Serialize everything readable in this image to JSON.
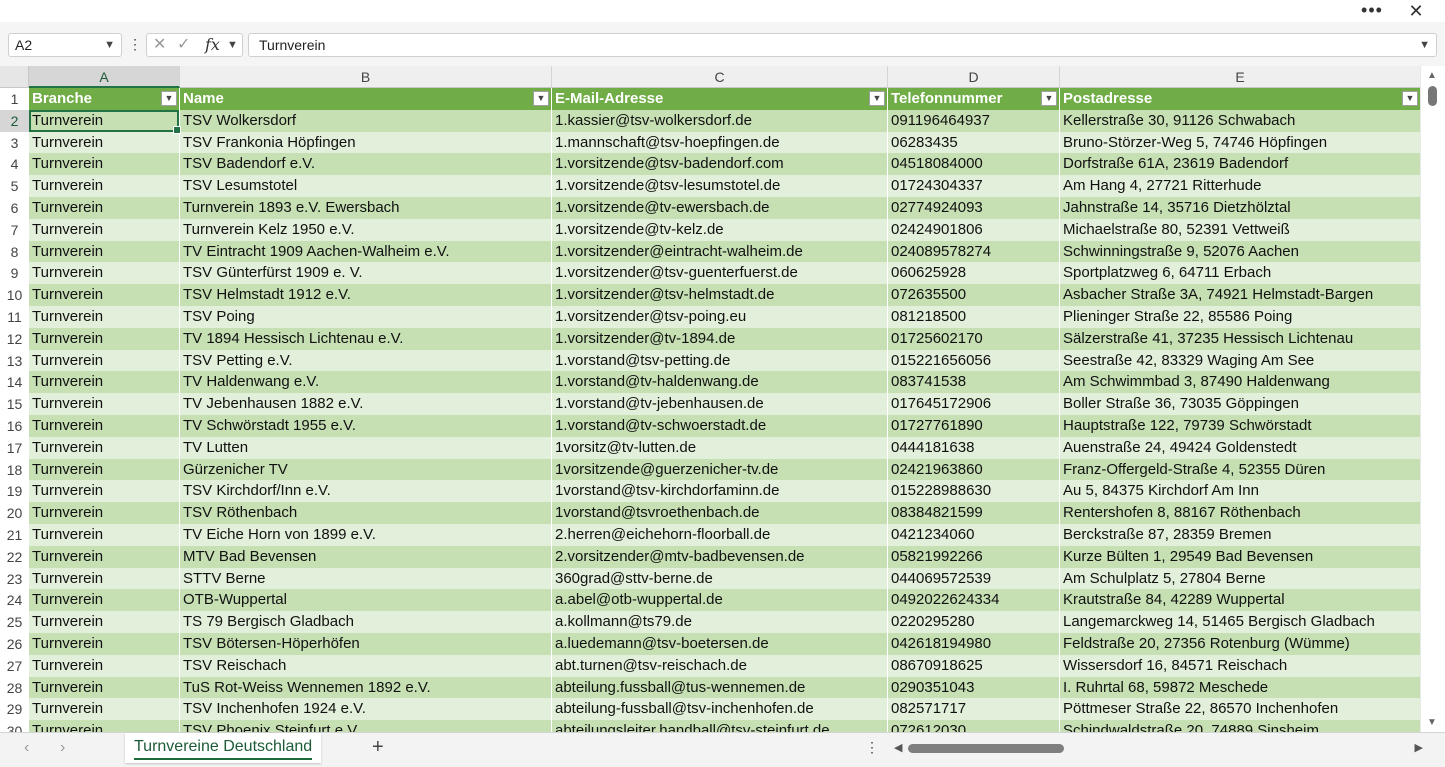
{
  "window": {
    "more_label": "•••",
    "close_label": "✕"
  },
  "formula_bar": {
    "name_box": "A2",
    "cancel_icon": "✕",
    "enter_icon": "✓",
    "fx_label": "fx",
    "content": "Turnverein"
  },
  "columns": [
    "A",
    "B",
    "C",
    "D",
    "E"
  ],
  "table": {
    "headers": [
      "Branche",
      "Name",
      "E-Mail-Adresse",
      "Telefonnummer",
      "Postadresse"
    ],
    "rows": [
      {
        "num": "2",
        "cells": [
          "Turnverein",
          "TSV Wolkersdorf",
          "1.kassier@tsv-wolkersdorf.de",
          "091196464937",
          "Kellerstraße 30, 91126 Schwabach"
        ]
      },
      {
        "num": "3",
        "cells": [
          "Turnverein",
          "TSV Frankonia Höpfingen",
          "1.mannschaft@tsv-hoepfingen.de",
          "06283435",
          "Bruno-Störzer-Weg 5, 74746 Höpfingen"
        ]
      },
      {
        "num": "4",
        "cells": [
          "Turnverein",
          "TSV Badendorf e.V.",
          "1.vorsitzende@tsv-badendorf.com",
          "04518084000",
          "Dorfstraße 61A, 23619 Badendorf"
        ]
      },
      {
        "num": "5",
        "cells": [
          "Turnverein",
          "TSV Lesumstotel",
          "1.vorsitzende@tsv-lesumstotel.de",
          "01724304337",
          "Am Hang 4, 27721 Ritterhude"
        ]
      },
      {
        "num": "6",
        "cells": [
          "Turnverein",
          "Turnverein 1893 e.V. Ewersbach",
          "1.vorsitzende@tv-ewersbach.de",
          "02774924093",
          "Jahnstraße 14, 35716 Dietzhölztal"
        ]
      },
      {
        "num": "7",
        "cells": [
          "Turnverein",
          "Turnverein Kelz 1950 e.V.",
          "1.vorsitzende@tv-kelz.de",
          "02424901806",
          "Michaelstraße 80, 52391 Vettweiß"
        ]
      },
      {
        "num": "8",
        "cells": [
          "Turnverein",
          "TV Eintracht 1909 Aachen-Walheim e.V.",
          "1.vorsitzender@eintracht-walheim.de",
          "024089578274",
          "Schwinningstraße 9, 52076 Aachen"
        ]
      },
      {
        "num": "9",
        "cells": [
          "Turnverein",
          "TSV Günterfürst 1909 e. V.",
          "1.vorsitzender@tsv-guenterfuerst.de",
          "060625928",
          "Sportplatzweg 6, 64711 Erbach"
        ]
      },
      {
        "num": "10",
        "cells": [
          "Turnverein",
          "TSV Helmstadt 1912 e.V.",
          "1.vorsitzender@tsv-helmstadt.de",
          "072635500",
          "Asbacher Straße 3A, 74921 Helmstadt-Bargen"
        ]
      },
      {
        "num": "11",
        "cells": [
          "Turnverein",
          "TSV Poing",
          "1.vorsitzender@tsv-poing.eu",
          "081218500",
          "Plieninger Straße 22, 85586 Poing"
        ]
      },
      {
        "num": "12",
        "cells": [
          "Turnverein",
          "TV 1894 Hessisch Lichtenau e.V.",
          "1.vorsitzender@tv-1894.de",
          "01725602170",
          "Sälzerstraße 41, 37235 Hessisch Lichtenau"
        ]
      },
      {
        "num": "13",
        "cells": [
          "Turnverein",
          "TSV Petting e.V.",
          "1.vorstand@tsv-petting.de",
          "015221656056",
          "Seestraße 42, 83329 Waging Am See"
        ]
      },
      {
        "num": "14",
        "cells": [
          "Turnverein",
          "TV Haldenwang e.V.",
          "1.vorstand@tv-haldenwang.de",
          "083741538",
          "Am Schwimmbad 3, 87490 Haldenwang"
        ]
      },
      {
        "num": "15",
        "cells": [
          "Turnverein",
          "TV Jebenhausen 1882 e.V.",
          "1.vorstand@tv-jebenhausen.de",
          "017645172906",
          "Boller Straße 36, 73035 Göppingen"
        ]
      },
      {
        "num": "16",
        "cells": [
          "Turnverein",
          "TV Schwörstadt 1955 e.V.",
          "1.vorstand@tv-schwoerstadt.de",
          "01727761890",
          "Hauptstraße 122, 79739 Schwörstadt"
        ]
      },
      {
        "num": "17",
        "cells": [
          "Turnverein",
          "TV Lutten",
          "1vorsitz@tv-lutten.de",
          "0444181638",
          "Auenstraße 24, 49424 Goldenstedt"
        ]
      },
      {
        "num": "18",
        "cells": [
          "Turnverein",
          "Gürzenicher TV",
          "1vorsitzende@guerzenicher-tv.de",
          "02421963860",
          "Franz-Offergeld-Straße 4, 52355 Düren"
        ]
      },
      {
        "num": "19",
        "cells": [
          "Turnverein",
          "TSV Kirchdorf/Inn e.V.",
          "1vorstand@tsv-kirchdorfaminn.de",
          "015228988630",
          "Au 5, 84375 Kirchdorf Am Inn"
        ]
      },
      {
        "num": "20",
        "cells": [
          "Turnverein",
          "TSV Röthenbach",
          "1vorstand@tsvroethenbach.de",
          "08384821599",
          "Rentershofen 8, 88167 Röthenbach"
        ]
      },
      {
        "num": "21",
        "cells": [
          "Turnverein",
          "TV Eiche Horn von 1899 e.V.",
          "2.herren@eichehorn-floorball.de",
          "0421234060",
          "Berckstraße 87, 28359 Bremen"
        ]
      },
      {
        "num": "22",
        "cells": [
          "Turnverein",
          "MTV Bad Bevensen",
          "2.vorsitzender@mtv-badbevensen.de",
          "05821992266",
          "Kurze Bülten 1, 29549 Bad Bevensen"
        ]
      },
      {
        "num": "23",
        "cells": [
          "Turnverein",
          "STTV Berne",
          "360grad@sttv-berne.de",
          "044069572539",
          "Am Schulplatz 5, 27804 Berne"
        ]
      },
      {
        "num": "24",
        "cells": [
          "Turnverein",
          "OTB-Wuppertal",
          "a.abel@otb-wuppertal.de",
          "0492022624334",
          "Krautstraße 84, 42289 Wuppertal"
        ]
      },
      {
        "num": "25",
        "cells": [
          "Turnverein",
          "TS 79 Bergisch Gladbach",
          "a.kollmann@ts79.de",
          "0220295280",
          "Langemarckweg 14, 51465 Bergisch Gladbach"
        ]
      },
      {
        "num": "26",
        "cells": [
          "Turnverein",
          "TSV Bötersen-Höperhöfen",
          "a.luedemann@tsv-boetersen.de",
          "042618194980",
          "Feldstraße 20, 27356 Rotenburg (Wümme)"
        ]
      },
      {
        "num": "27",
        "cells": [
          "Turnverein",
          "TSV Reischach",
          "abt.turnen@tsv-reischach.de",
          "08670918625",
          "Wissersdorf 16, 84571 Reischach"
        ]
      },
      {
        "num": "28",
        "cells": [
          "Turnverein",
          "TuS Rot-Weiss Wennemen 1892 e.V.",
          "abteilung.fussball@tus-wennemen.de",
          "0290351043",
          "I. Ruhrtal 68, 59872 Meschede"
        ]
      },
      {
        "num": "29",
        "cells": [
          "Turnverein",
          "TSV Inchenhofen 1924 e.V.",
          "abteilung-fussball@tsv-inchenhofen.de",
          "082571717",
          "Pöttmeser Straße 22, 86570 Inchenhofen"
        ]
      },
      {
        "num": "30",
        "cells": [
          "Turnverein",
          "TSV Phoenix Steinfurt e.V.",
          "abteilungsleiter.handball@tsv-steinfurt.de",
          "072612030",
          "Schindwaldstraße 20, 74889 Sinsheim"
        ]
      }
    ]
  },
  "sheets": {
    "active": "Turnvereine Deutschland",
    "add_label": "+"
  },
  "colors": {
    "header_green": "#70ad47",
    "band_dark": "#c6e0b4",
    "band_light": "#e2efda",
    "accent": "#217346"
  }
}
